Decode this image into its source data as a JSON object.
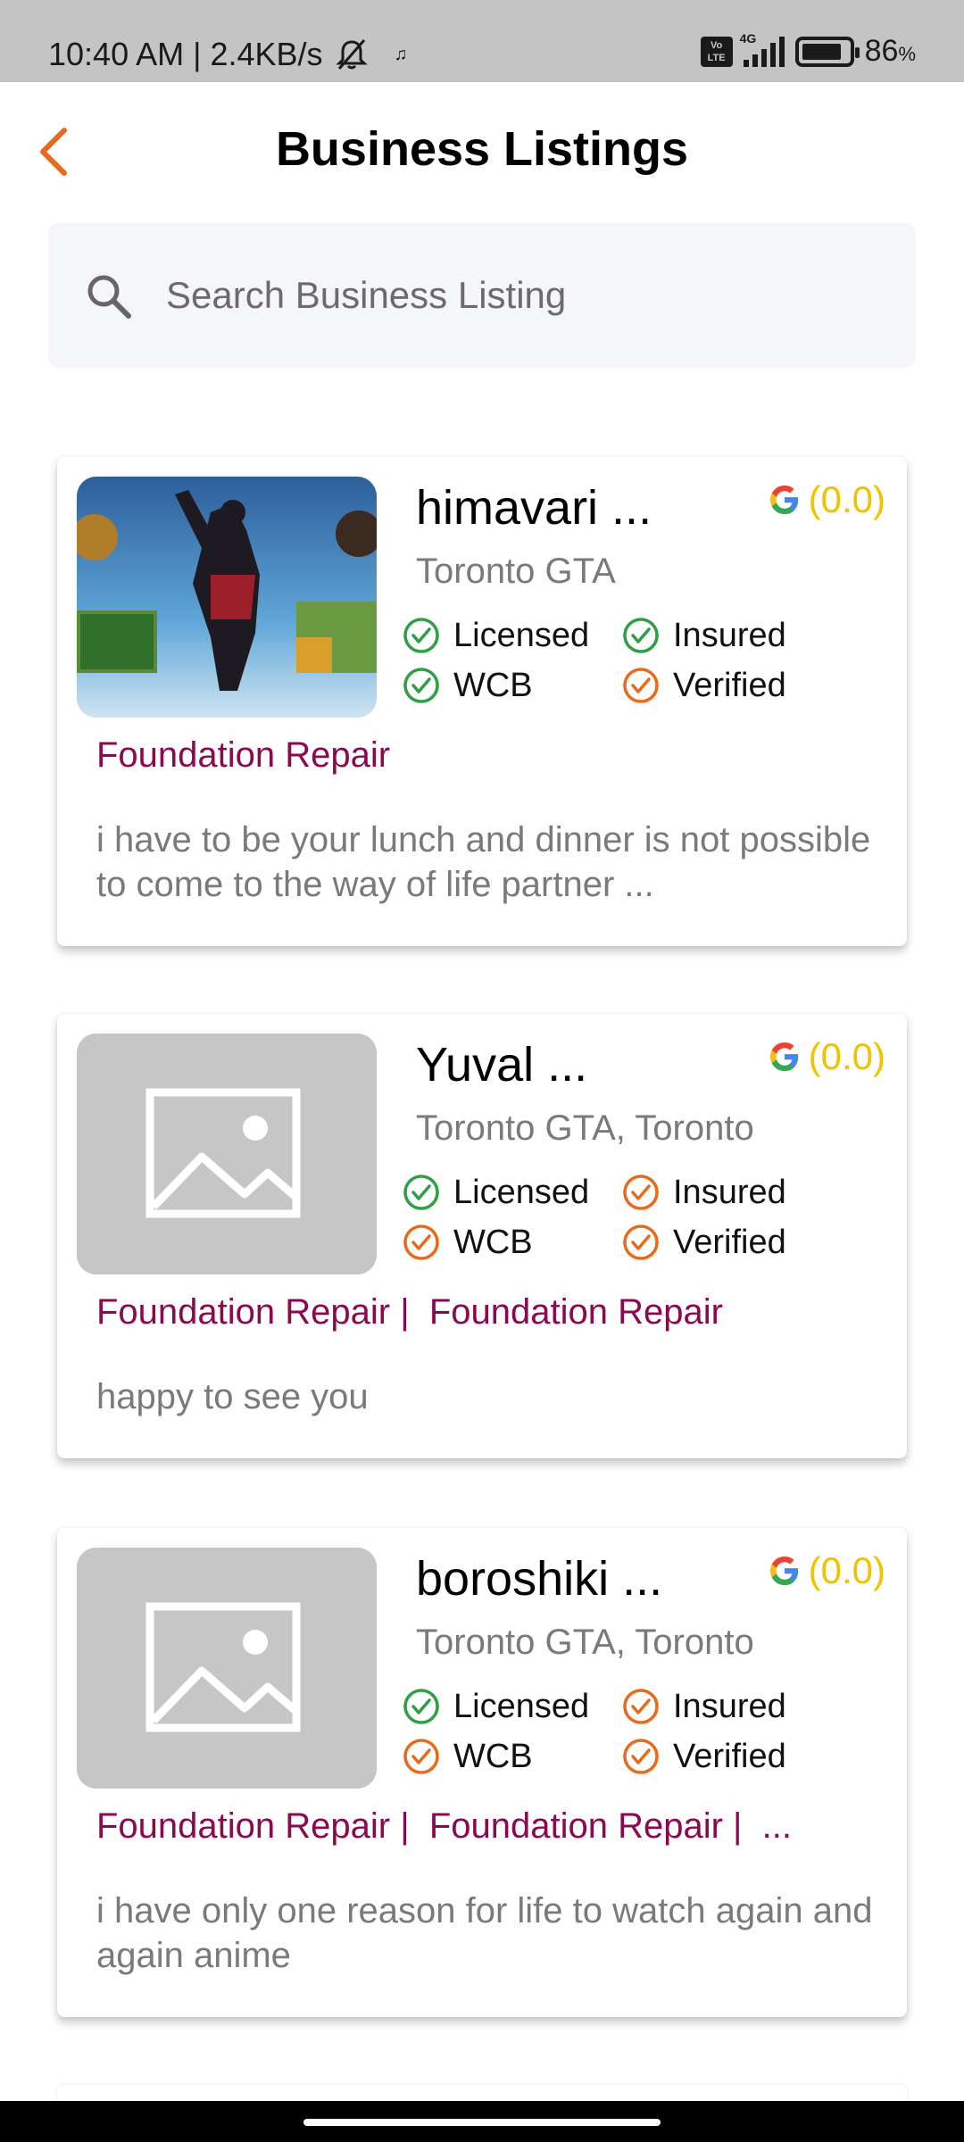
{
  "status_bar": {
    "time_speed": "10:40 AM | 2.4KB/s",
    "note": "♫",
    "volte": "Vo LTE",
    "network": "4G",
    "battery_value": "86",
    "battery_unit": "%"
  },
  "header": {
    "title": "Business Listings"
  },
  "search": {
    "placeholder": "Search Business Listing"
  },
  "colors": {
    "accent_orange": "#e86a1c",
    "check_green": "#2e9e47",
    "category": "#8b0a4f",
    "rating": "#f2c200"
  },
  "listings": [
    {
      "name": "himavari ...",
      "rating": "(0.0)",
      "location": "Toronto GTA",
      "badges": [
        {
          "label": "Licensed",
          "status": "green"
        },
        {
          "label": "Insured",
          "status": "green"
        },
        {
          "label": "WCB",
          "status": "green"
        },
        {
          "label": "Verified",
          "status": "orange"
        }
      ],
      "categories": "Foundation Repair",
      "description": "i have to be your lunch and dinner is not possible to come to the way of life partner ...",
      "image": "photo"
    },
    {
      "name": "Yuval ...",
      "rating": "(0.0)",
      "location": "Toronto GTA, Toronto",
      "badges": [
        {
          "label": "Licensed",
          "status": "green"
        },
        {
          "label": "Insured",
          "status": "orange"
        },
        {
          "label": "WCB",
          "status": "orange"
        },
        {
          "label": "Verified",
          "status": "orange"
        }
      ],
      "categories": "Foundation Repair |  Foundation Repair",
      "description": "happy to see you",
      "image": "placeholder"
    },
    {
      "name": "boroshiki ...",
      "rating": "(0.0)",
      "location": "Toronto GTA, Toronto",
      "badges": [
        {
          "label": "Licensed",
          "status": "green"
        },
        {
          "label": "Insured",
          "status": "orange"
        },
        {
          "label": "WCB",
          "status": "orange"
        },
        {
          "label": "Verified",
          "status": "orange"
        }
      ],
      "categories": "Foundation Repair |  Foundation Repair |  ...",
      "description": "i have only one reason for life to watch again and again anime",
      "image": "placeholder"
    }
  ]
}
